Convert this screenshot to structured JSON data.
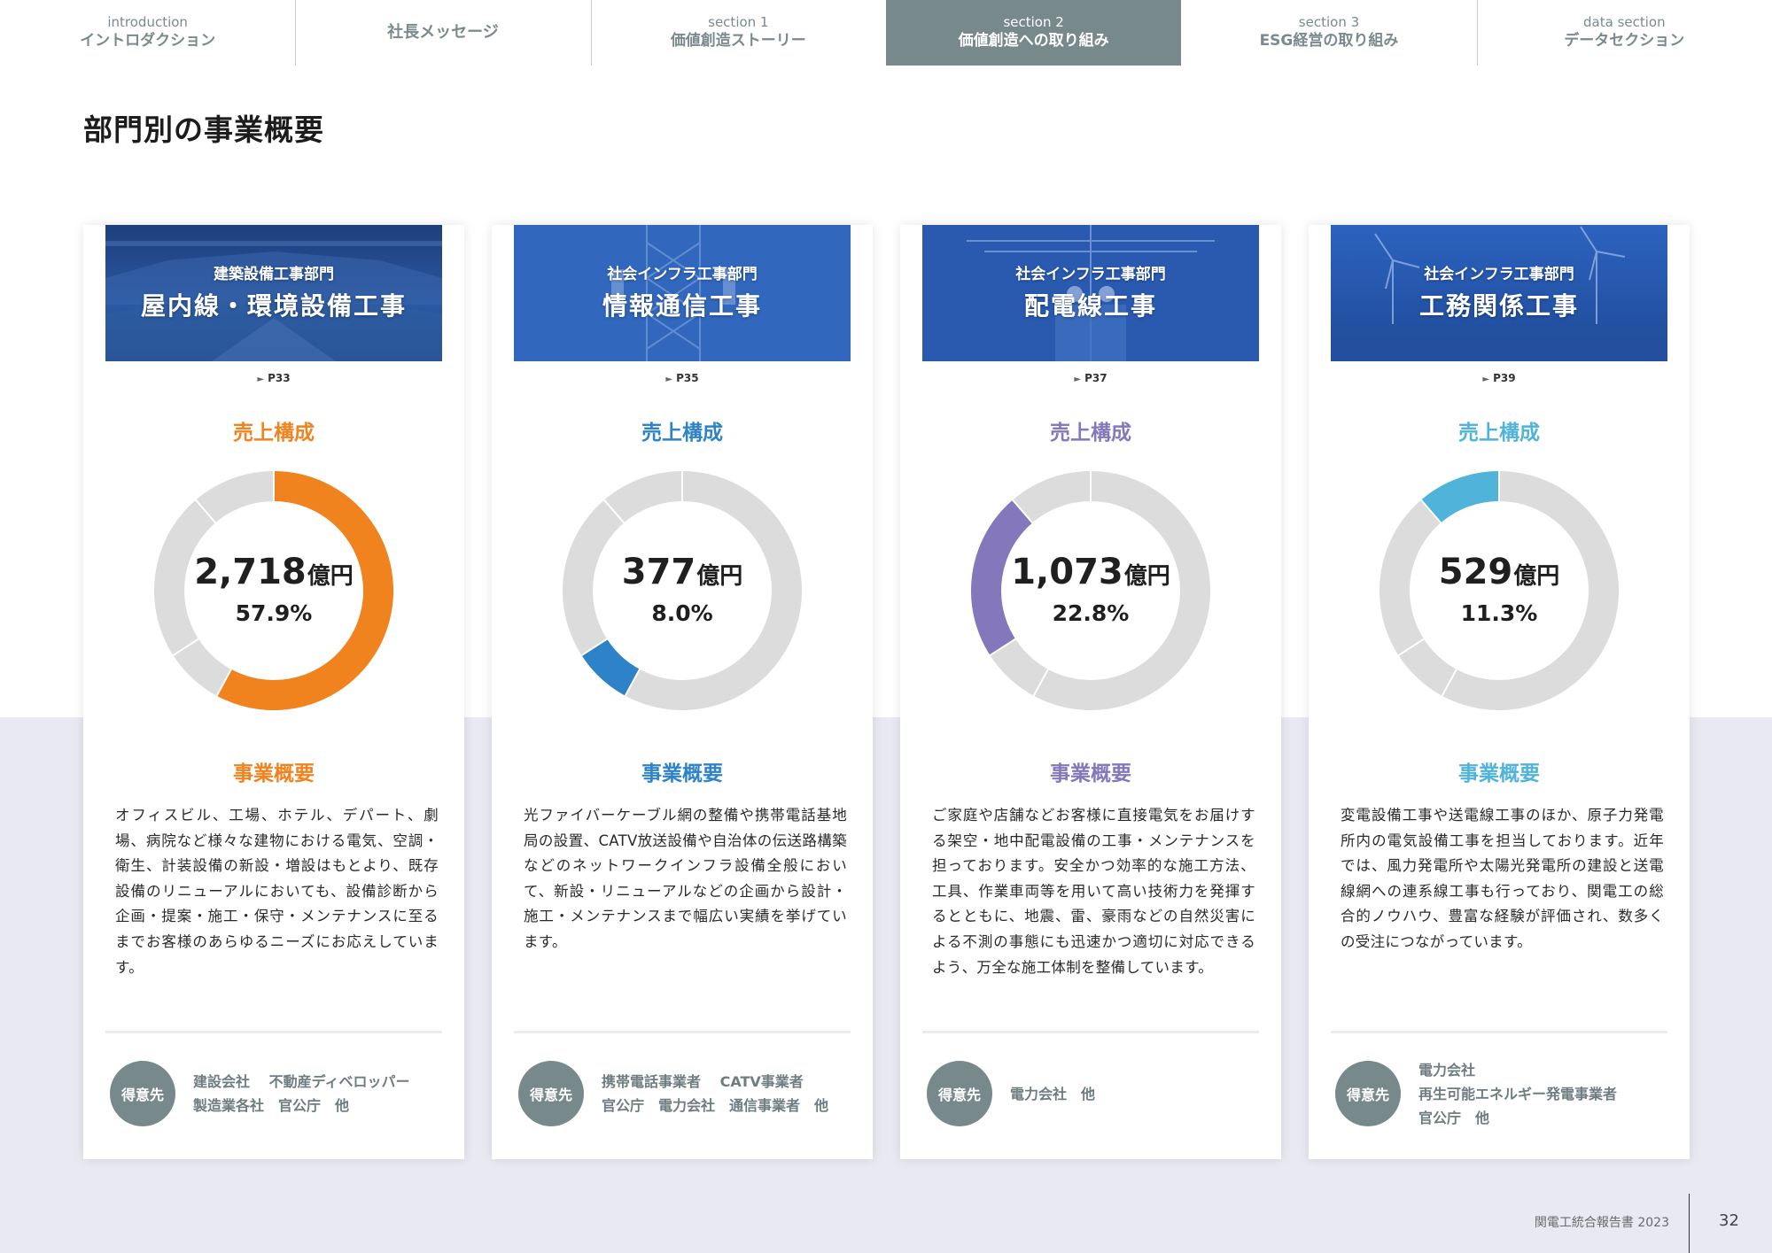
{
  "nav": [
    {
      "sub": "introduction",
      "label": "イントロダクション",
      "active": false
    },
    {
      "sub": "",
      "label": "社長メッセージ",
      "active": false
    },
    {
      "sub": "section 1",
      "label": "価値創造ストーリー",
      "active": false
    },
    {
      "sub": "section 2",
      "label": "価値創造への取り組み",
      "active": true
    },
    {
      "sub": "section 3",
      "label": "ESG経営の取り組み",
      "active": false
    },
    {
      "sub": "data section",
      "label": "データセクション",
      "active": false
    }
  ],
  "page_title": "部門別の事業概要",
  "labels": {
    "sales": "売上構成",
    "overview": "事業概要",
    "customers": "得意先",
    "unit": "億円"
  },
  "divisions": [
    {
      "dept": "建築設備工事部門",
      "name": "屋内線・環境設備工事",
      "page": "P33",
      "amount": "2,718",
      "percent": "57.9%",
      "share": 57.9,
      "color": "#f0831e",
      "description": "オフィスビル、工場、ホテル、デパート、劇場、病院など様々な建物における電気、空調・衛生、計装設備の新設・増設はもとより、既存設備のリニューアルにおいても、設備診断から企画・提案・施工・保守・メンテナンスに至るまでお客様のあらゆるニーズにお応えしています。",
      "customers": [
        "建設会社　 不動産ディベロッパー",
        "製造業各社　官公庁　他"
      ]
    },
    {
      "dept": "社会インフラ工事部門",
      "name": "情報通信工事",
      "page": "P35",
      "amount": "377",
      "percent": "8.0%",
      "share": 8.0,
      "color": "#2e83c8",
      "description": "光ファイバーケーブル網の整備や携帯電話基地局の設置、CATV放送設備や自治体の伝送路構築などのネットワークインフラ設備全般において、新設・リニューアルなどの企画から設計・施工・メンテナンスまで幅広い実績を挙げています。",
      "customers": [
        "携帯電話事業者　 CATV事業者",
        "官公庁　電力会社　通信事業者　他"
      ]
    },
    {
      "dept": "社会インフラ工事部門",
      "name": "配電線工事",
      "page": "P37",
      "amount": "1,073",
      "percent": "22.8%",
      "share": 22.8,
      "color": "#8577bb",
      "description": "ご家庭や店舗などお客様に直接電気をお届けする架空・地中配電設備の工事・メンテナンスを担っております。安全かつ効率的な施工方法、工具、作業車両等を用いて高い技術力を発揮するとともに、地震、雷、豪雨などの自然災害による不測の事態にも迅速かつ適切に対応できるよう、万全な施工体制を整備しています。",
      "customers": [
        "電力会社　他"
      ]
    },
    {
      "dept": "社会インフラ工事部門",
      "name": "工務関係工事",
      "page": "P39",
      "amount": "529",
      "percent": "11.3%",
      "share": 11.3,
      "color": "#4fb3da",
      "description": "変電設備工事や送電線工事のほか、原子力発電所内の電気設備工事を担当しております。近年では、風力発電所や太陽光発電所の建設と送電線網への連系線工事も行っており、関電工の総合的ノウハウ、豊富な経験が評価され、数多くの受注につながっています。",
      "customers": [
        "電力会社",
        "再生可能エネルギー発電事業者",
        "官公庁　他"
      ]
    }
  ],
  "footer": {
    "report": "関電工統合報告書 2023",
    "page": "32"
  }
}
